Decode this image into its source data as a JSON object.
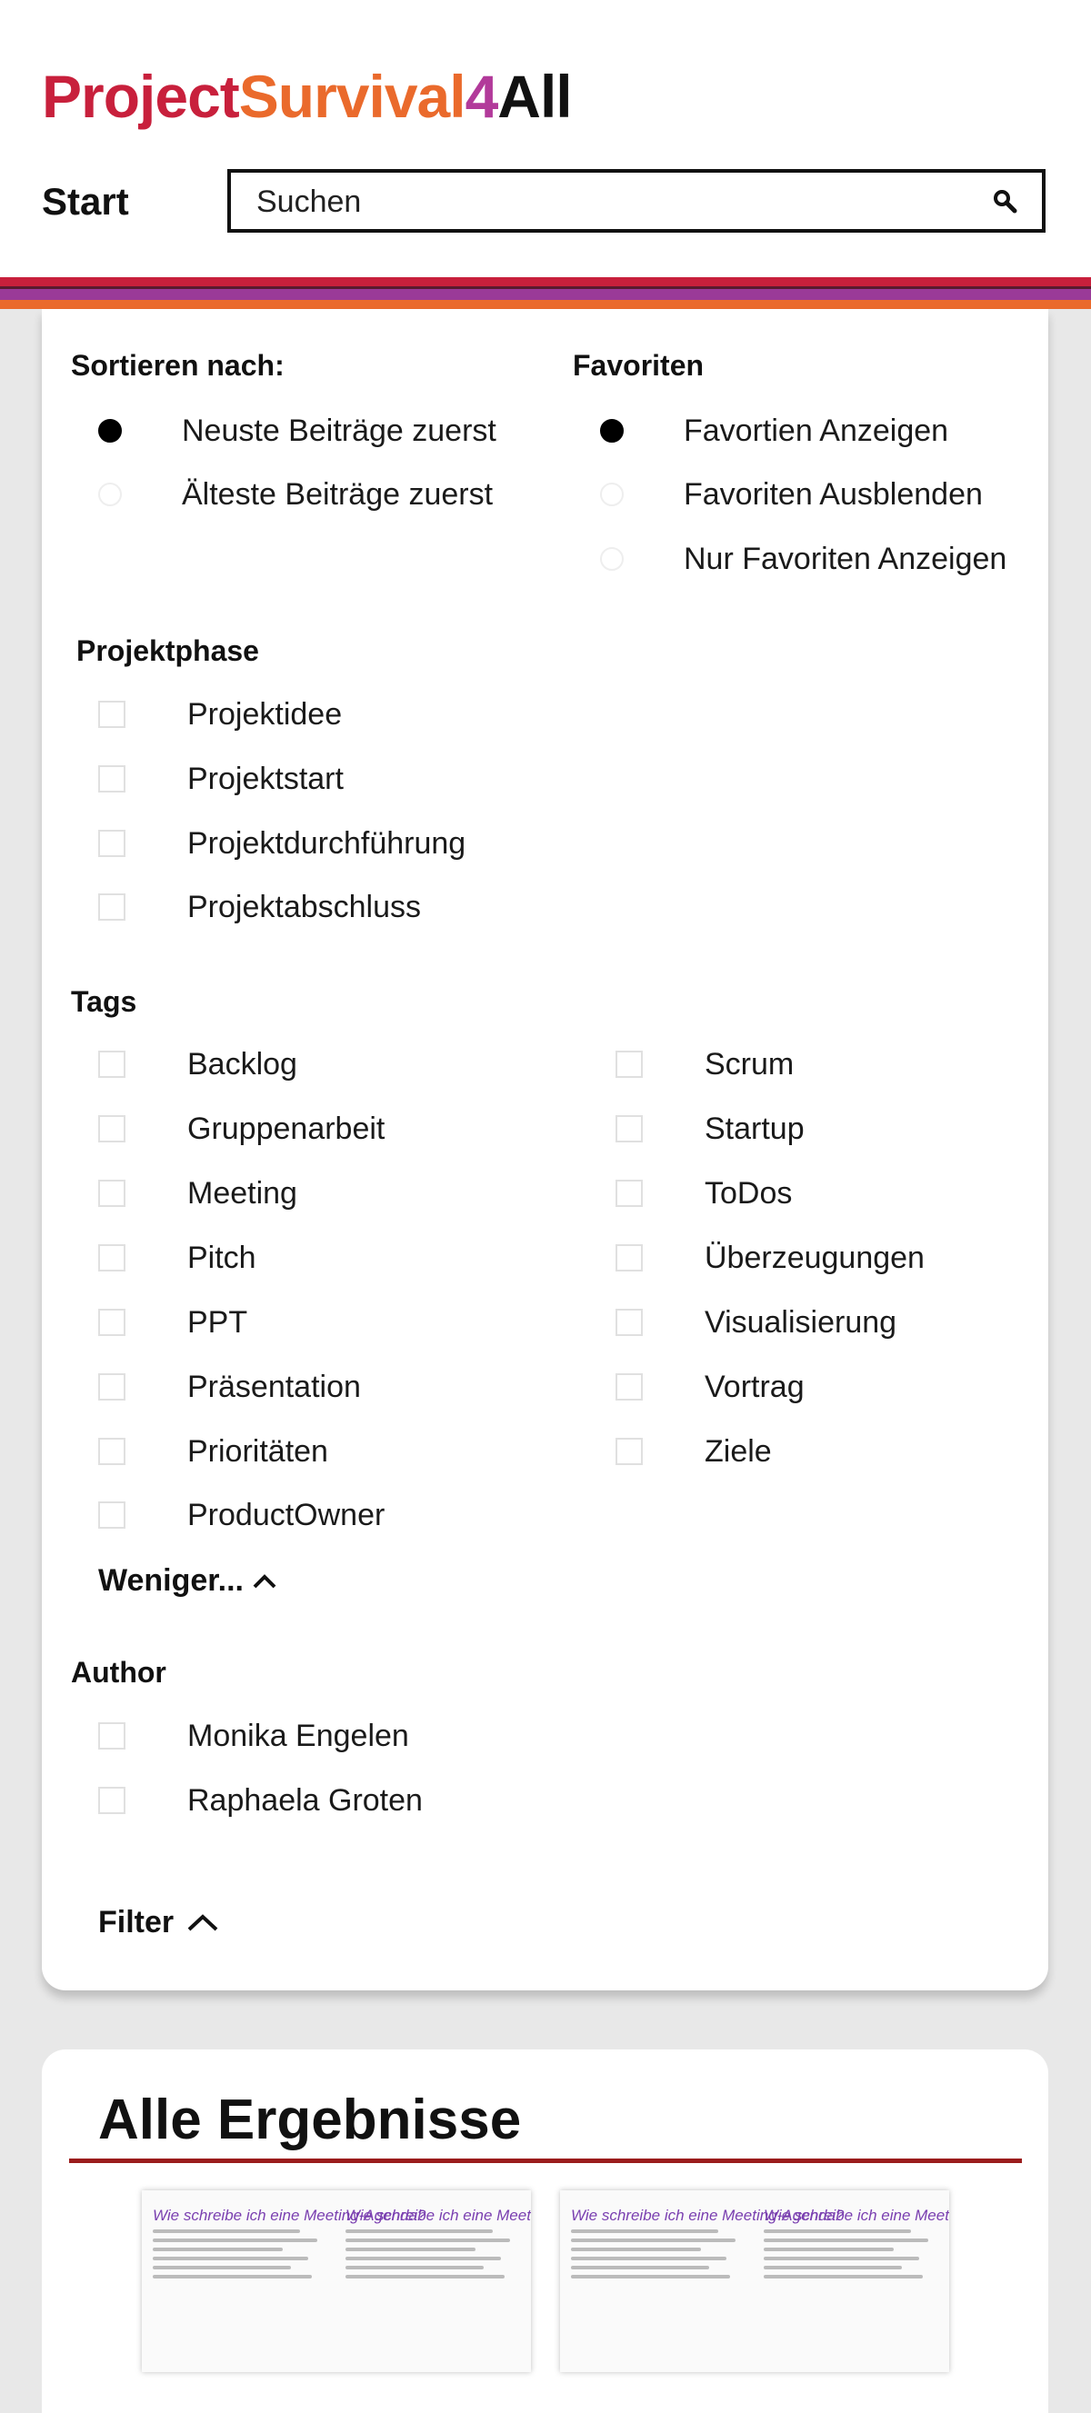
{
  "header": {
    "logo_parts": [
      "Project",
      "Survival",
      "4",
      "All"
    ],
    "nav_start": "Start",
    "search_placeholder": "Suchen"
  },
  "colors": {
    "stripe_red": "#c8203c",
    "stripe_purple": "#9a3a98",
    "stripe_orange": "#ea6a2c",
    "accent_line": "#9b1c1c"
  },
  "sort": {
    "title": "Sortieren nach:",
    "options": [
      {
        "label": "Neuste Beiträge zuerst",
        "selected": true
      },
      {
        "label": "Älteste Beiträge zuerst",
        "selected": false
      }
    ]
  },
  "favorites": {
    "title": "Favoriten",
    "options": [
      {
        "label": "Favortien Anzeigen",
        "selected": true
      },
      {
        "label": "Favoriten Ausblenden",
        "selected": false
      },
      {
        "label": "Nur Favoriten Anzeigen",
        "selected": false
      }
    ]
  },
  "phase": {
    "title": "Projektphase",
    "options": [
      "Projektidee",
      "Projektstart",
      "Projektdurchführung",
      "Projektabschluss"
    ]
  },
  "tags": {
    "title": "Tags",
    "left": [
      "Backlog",
      "Gruppenarbeit",
      "Meeting",
      "Pitch",
      "PPT",
      "Präsentation",
      "Prioritäten",
      "ProductOwner"
    ],
    "right": [
      "Scrum",
      "Startup",
      "ToDos",
      "Überzeugungen",
      "Visualisierung",
      "Vortrag",
      "Ziele"
    ],
    "less_label": "Weniger..."
  },
  "author": {
    "title": "Author",
    "options": [
      "Monika Engelen",
      "Raphaela Groten"
    ]
  },
  "filter_toggle": "Filter",
  "results": {
    "title": "Alle Ergebnisse",
    "thumbnails": [
      {
        "left_title": "Wie schreibe ich eine Meeting-Agenda?",
        "right_title": "Wie schreibe ich eine Meeting-Agenda?"
      },
      {
        "left_title": "Wie schreibe ich eine Meeting-Agenda?",
        "right_title": "Wie schreibe ich eine Meeting-Agenda?"
      }
    ]
  }
}
